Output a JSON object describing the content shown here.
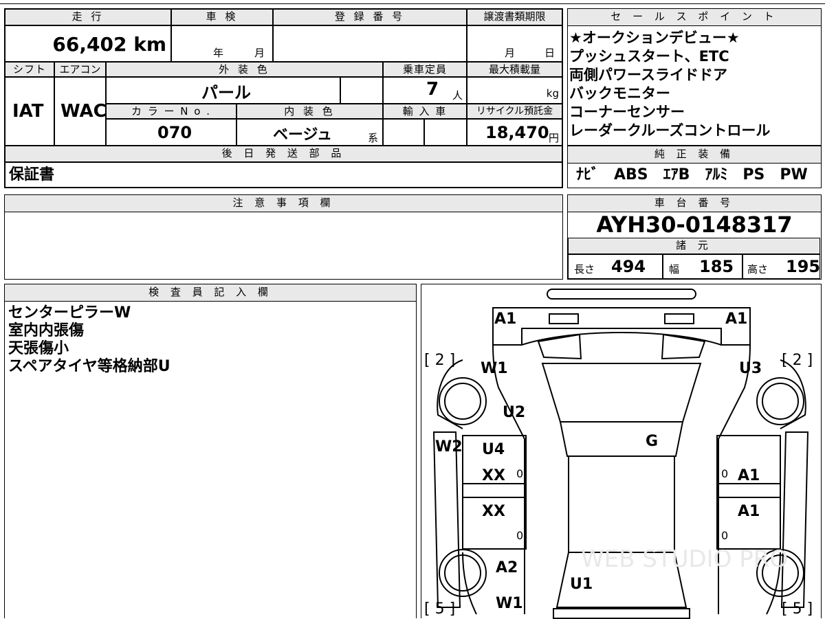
{
  "header_labels": {
    "mileage": "走 行",
    "inspection": "車 検",
    "registration": "登 録 番 号",
    "transfer_deadline": "譲渡書類期限",
    "shift": "シフト",
    "aircon": "エアコン",
    "exterior_color": "外 装 色",
    "capacity": "乗車定員",
    "max_load": "最大積載量",
    "color_no": "カ ラ ー N o .",
    "interior_color": "内 装 色",
    "import": "輸 入 車",
    "recycle_fee": "リサイクル預託金",
    "later_parts": "後 日 発 送 部 品",
    "sales_points": "セ ー ル ス ポ イ ン ト",
    "genuine_equipment": "純 正 装 備",
    "notes": "注 意 事 項 欄",
    "chassis_no": "車 台 番 号",
    "specs": "諸 元",
    "inspector": "検 査 員 記 入 欄"
  },
  "vehicle": {
    "mileage": "66,402 km",
    "inspection_year_unit": "年",
    "inspection_month_unit": "月",
    "transfer_month_unit": "月",
    "transfer_day_unit": "日",
    "shift": "IAT",
    "aircon": "WAC",
    "exterior_color": "パール",
    "capacity": "7",
    "capacity_unit": "人",
    "max_load_unit": "kg",
    "color_no": "070",
    "interior_color": "ベージュ",
    "interior_color_suffix": "系",
    "recycle_fee": "18,470",
    "recycle_unit": "円",
    "later_parts": "保証書"
  },
  "sales_points": [
    "★オークションデビュー★",
    "プッシュスタート、ETC",
    "両側パワースライドドア",
    "バックモニター",
    "コーナーセンサー",
    "レーダークルーズコントロール"
  ],
  "genuine_equipment": "ﾅﾋﾞ　ABS　ｴｱB　ｱﾙﾐ　PS　PW",
  "chassis_no": "AYH30-0148317",
  "specs": {
    "length_label": "長さ",
    "length": "494",
    "width_label": "幅",
    "width": "185",
    "height_label": "高さ",
    "height": "195"
  },
  "inspector_notes": [
    "センターピラーW",
    "室内内張傷",
    "天張傷小",
    "スペアタイヤ等格納部U"
  ],
  "diagram": {
    "tire_front_left": "[ 2 ]",
    "tire_front_right": "[ 2 ]",
    "tire_rear_left": "[ 5 ]",
    "tire_rear_right": "[ 5 ]",
    "marks": {
      "front_left": "A1",
      "front_right": "A1",
      "fender_fl": "W1",
      "fender_fr": "U3",
      "hood_left": "U2",
      "pillar_left": "W2",
      "roof": "G",
      "door_fl": "U4",
      "door_fl2": "XX",
      "door_rl": "XX",
      "door_fr": "A1",
      "door_rr": "A1",
      "rear_fender_l": "A2",
      "rear_l": "W1",
      "tailgate": "U1",
      "zero": "0"
    },
    "watermark": "WEB STUDIO PRO"
  }
}
